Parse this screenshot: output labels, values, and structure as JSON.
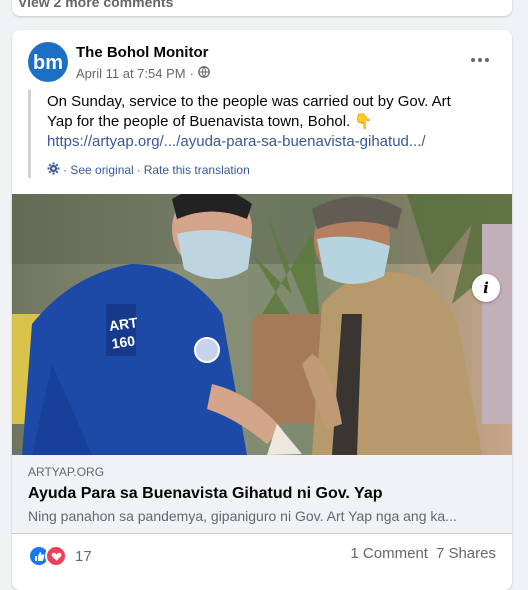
{
  "previous_card": {
    "comments_link": "View 2 more comments"
  },
  "post": {
    "page_name": "The Bohol Monitor",
    "timestamp": "April 11 at 7:54 PM",
    "separator": "·",
    "avatar_letters": "bm",
    "text": "On Sunday, service to the people was carried out by Gov. Art Yap for the people of Buenavista town, Bohol. 👇",
    "link": "https://artyap.org/.../ayuda-para-sa-buenavista-gihatud.../",
    "see_original": "· See original",
    "dot": "·",
    "rate_translation": "Rate this translation"
  },
  "photo": {
    "shirt_text_line1": "ART",
    "shirt_text_line2": "160"
  },
  "link_preview": {
    "domain": "ARTYAP.ORG",
    "title": "Ayuda Para sa Buenavista Gihatud ni Gov. Yap",
    "description": "Ning panahon sa pandemya, gipaniguro ni Gov. Art Yap nga ang ka..."
  },
  "footer": {
    "reaction_count": "17",
    "comments": "1 Comment",
    "shares": "7 Shares"
  },
  "colors": {
    "facebook_blue": "#1877f2",
    "love_red": "#f33e58",
    "brand_blue": "#1d6fc4"
  }
}
